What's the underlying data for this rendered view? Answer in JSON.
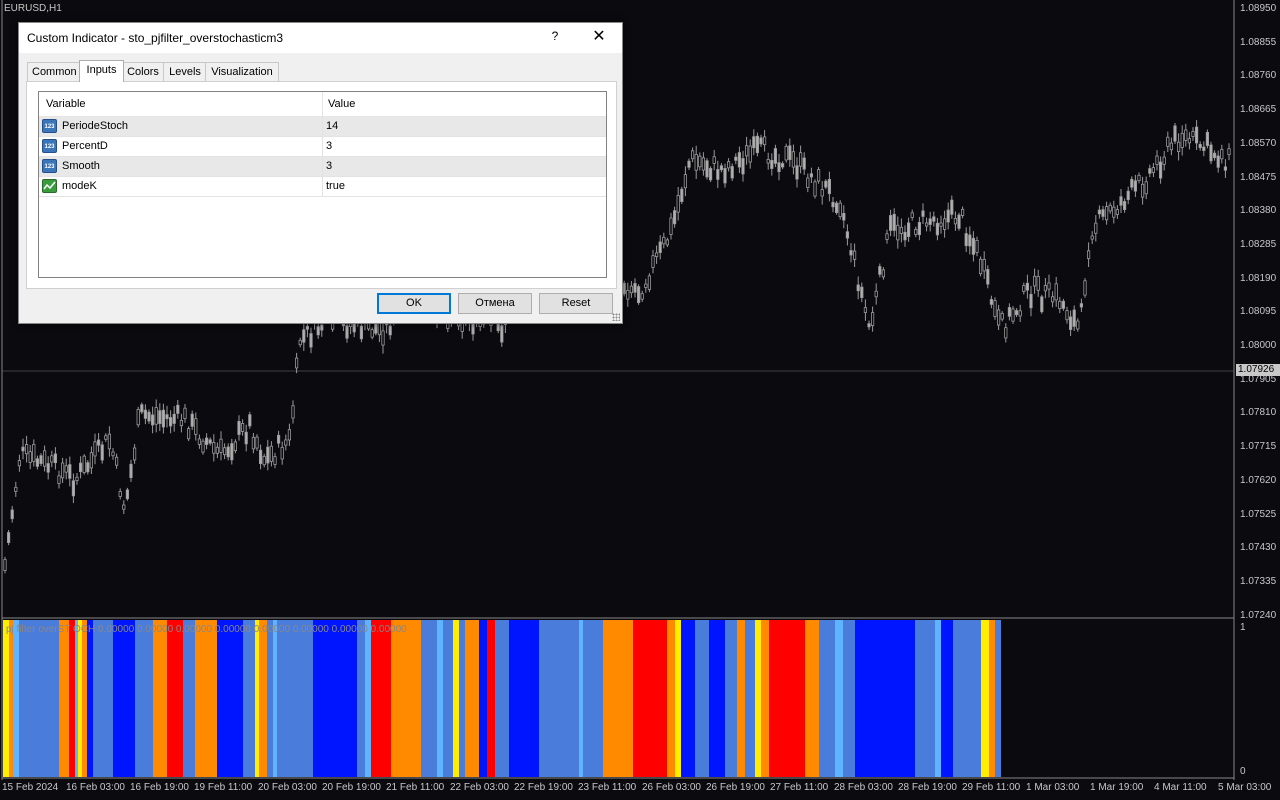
{
  "chart": {
    "symbol": "EURUSD,H1",
    "current_price": "1.07926",
    "price_ticks": [
      "1.08950",
      "1.08855",
      "1.08760",
      "1.08665",
      "1.08570",
      "1.08475",
      "1.08380",
      "1.08285",
      "1.08190",
      "1.08095",
      "1.08000",
      "1.07905",
      "1.07810",
      "1.07715",
      "1.07620",
      "1.07525",
      "1.07430",
      "1.07335",
      "1.07240"
    ],
    "time_ticks": [
      "15 Feb 2024",
      "16 Feb 03:00",
      "16 Feb 19:00",
      "19 Feb 11:00",
      "20 Feb 03:00",
      "20 Feb 19:00",
      "21 Feb 11:00",
      "22 Feb 03:00",
      "22 Feb 19:00",
      "23 Feb 11:00",
      "26 Feb 03:00",
      "26 Feb 19:00",
      "27 Feb 11:00",
      "28 Feb 03:00",
      "28 Feb 19:00",
      "29 Feb 11:00",
      "1 Mar 03:00",
      "1 Mar 19:00",
      "4 Mar 11:00",
      "5 Mar 03:00"
    ],
    "colors": {
      "background": "#0a0a0f",
      "candle": "#9a9a9a",
      "grid": "#3c3c3c",
      "text": "#c8c8c8"
    }
  },
  "indicator": {
    "label": "pj filter overST OCH 0.00000 0.00000 0.00000 0.00000 0.00000 0.00000 0.00000 0.00000",
    "scale_top": "1",
    "scale_bottom": "0",
    "colors": {
      "blue": "#0015ff",
      "light_blue": "#4a7cdc",
      "sky": "#5fb4ff",
      "red": "#ff0000",
      "orange": "#ff8a00",
      "yellow": "#ffee00"
    }
  },
  "dialog": {
    "title": "Custom Indicator - sto_pjfilter_overstochasticm3",
    "help_label": "?",
    "close_label": "✕",
    "tabs": [
      "Common",
      "Inputs",
      "Colors",
      "Levels",
      "Visualization"
    ],
    "active_tab": "Inputs",
    "grid": {
      "headers": {
        "variable": "Variable",
        "value": "Value"
      },
      "rows": [
        {
          "name": "PeriodeStoch",
          "value": "14",
          "icon": "number-icon"
        },
        {
          "name": "PercentD",
          "value": "3",
          "icon": "number-icon"
        },
        {
          "name": "Smooth",
          "value": "3",
          "icon": "number-icon"
        },
        {
          "name": "modeK",
          "value": "true",
          "icon": "boolean-icon"
        }
      ]
    },
    "buttons": {
      "ok": "OK",
      "cancel": "Отмена",
      "reset": "Reset"
    },
    "icon_text": "123"
  }
}
